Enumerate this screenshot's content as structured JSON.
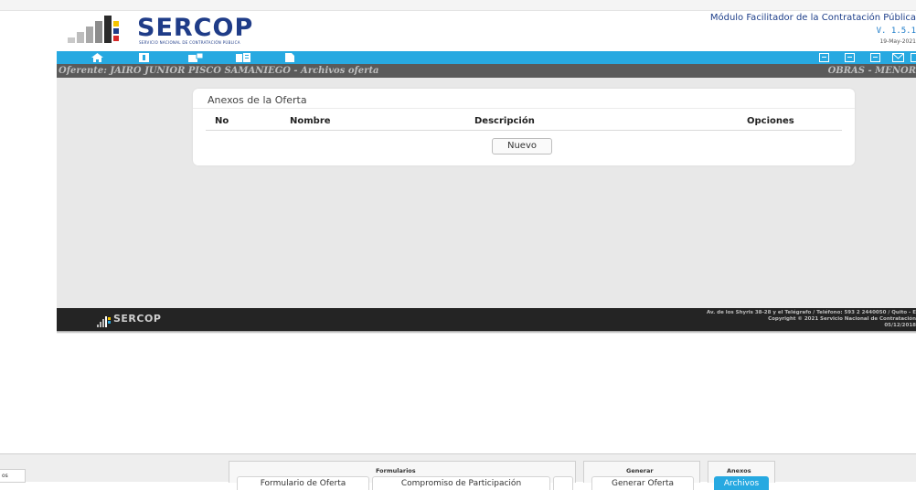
{
  "header": {
    "logo_text": "SERCOP",
    "logo_subtitle": "SERVICIO NACIONAL DE CONTRATACIÓN PÚBLICA",
    "module_title": "Módulo Facilitador de la Contratación Pública",
    "version": "V. 1.5.1",
    "date": "19-May-2021"
  },
  "navbar": {
    "icons": [
      "home-icon",
      "book-icon",
      "email-icon",
      "list-icon",
      "document-icon"
    ],
    "right_icons": [
      "form-icon",
      "form-icon",
      "form-icon",
      "mail-icon",
      "form-icon"
    ]
  },
  "title_bar": {
    "left": "Oferente: JAIRO JUNIOR PISCO SAMANIEGO - Archivos oferta",
    "right": "OBRAS - MENOR"
  },
  "panel": {
    "title": "Anexos de la Oferta",
    "columns": [
      "No",
      "Nombre",
      "Descripción",
      "Opciones"
    ],
    "new_button": "Nuevo"
  },
  "footer": {
    "logo_text": "SERCOP",
    "address_line1": "Av. de los Shyris 38-28 y el Telégrafo / Teléfono: 593 2 2440050 / Quito - E",
    "address_line2": "Copyright © 2021 Servicio Nacional de Contratación",
    "address_line3": "05/12/2018"
  },
  "bottom_toolbar": {
    "side_tab": "os",
    "groups": [
      {
        "label": "Formularios",
        "buttons": [
          "Formulario de Oferta",
          "Compromiso de Participación",
          ""
        ]
      },
      {
        "label": "Generar",
        "buttons": [
          "Generar Oferta"
        ]
      },
      {
        "label": "Anexos",
        "buttons": [
          "Archivos"
        ]
      }
    ]
  },
  "colors": {
    "accent": "#27a9e1",
    "brand": "#1f3c88",
    "title_bar": "#5a5a5a",
    "footer": "#242424"
  }
}
